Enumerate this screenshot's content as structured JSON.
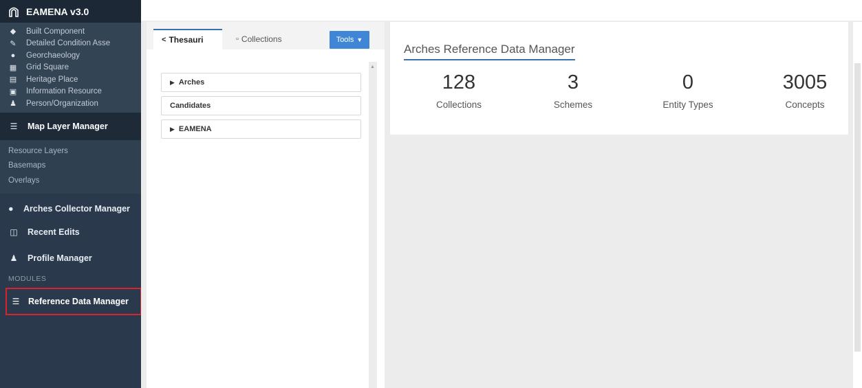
{
  "app": {
    "title": "EAMENA v3.0"
  },
  "sidebar": {
    "resource_items": [
      {
        "label": "Built Component",
        "icon": "cubes-icon"
      },
      {
        "label": "Detailed Condition Asse",
        "icon": "edit-icon"
      },
      {
        "label": "Georchaeology",
        "icon": "globe-icon"
      },
      {
        "label": "Grid Square",
        "icon": "grid-icon"
      },
      {
        "label": "Heritage Place",
        "icon": "bank-icon"
      },
      {
        "label": "Information Resource",
        "icon": "image-icon"
      },
      {
        "label": "Person/Organization",
        "icon": "users-icon"
      }
    ],
    "map_layer_manager": "Map Layer Manager",
    "map_links": [
      "Resource Layers",
      "Basemaps",
      "Overlays"
    ],
    "arches_collector": "Arches Collector Manager",
    "recent_edits": "Recent Edits",
    "profile_manager": "Profile Manager",
    "modules_label": "MODULES",
    "reference_data_manager": "Reference Data Manager"
  },
  "left_panel": {
    "tabs": {
      "thesauri": "Thesauri",
      "collections": "Collections"
    },
    "tools_label": "Tools",
    "tree": [
      {
        "label": "Arches",
        "expandable": true
      },
      {
        "label": "Candidates",
        "expandable": false
      },
      {
        "label": "EAMENA",
        "expandable": true
      }
    ]
  },
  "right_panel": {
    "title": "Arches Reference Data Manager",
    "stats": [
      {
        "value": "128",
        "label": "Collections"
      },
      {
        "value": "3",
        "label": "Schemes"
      },
      {
        "value": "0",
        "label": "Entity Types"
      },
      {
        "value": "3005",
        "label": "Concepts"
      }
    ]
  },
  "colors": {
    "sidebar_bg": "#2a3a4c",
    "accent_blue": "#3f87d6",
    "highlight_red": "#d9232e"
  }
}
